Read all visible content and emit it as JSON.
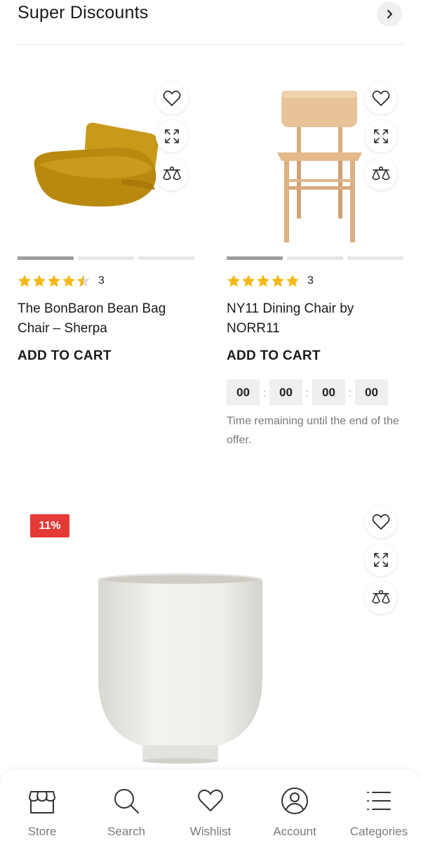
{
  "header": {
    "title": "Super Discounts"
  },
  "products": [
    {
      "title": "The BonBaron Bean Bag Chair – Sherpa",
      "rating": 4.5,
      "rating_count": "3",
      "cart_label": "ADD TO CART"
    },
    {
      "title": "NY11 Dining Chair by NORR11",
      "rating": 5,
      "rating_count": "3",
      "cart_label": "ADD TO CART",
      "countdown": {
        "days": "00",
        "hours": "00",
        "minutes": "00",
        "seconds": "00",
        "note": "Time remaining until the end of the offer."
      }
    },
    {
      "badge": "11%"
    }
  ],
  "bottom_nav": [
    {
      "label": "Store",
      "icon": "store-icon"
    },
    {
      "label": "Search",
      "icon": "search-icon"
    },
    {
      "label": "Wishlist",
      "icon": "heart-icon"
    },
    {
      "label": "Account",
      "icon": "account-icon"
    },
    {
      "label": "Categories",
      "icon": "menu-icon"
    }
  ],
  "colors": {
    "star": "#f6b817",
    "badge": "#e53935",
    "muted": "#7a7a7a",
    "bean_bag": "#c99a1a",
    "chair_wood": "#e8c39a"
  }
}
